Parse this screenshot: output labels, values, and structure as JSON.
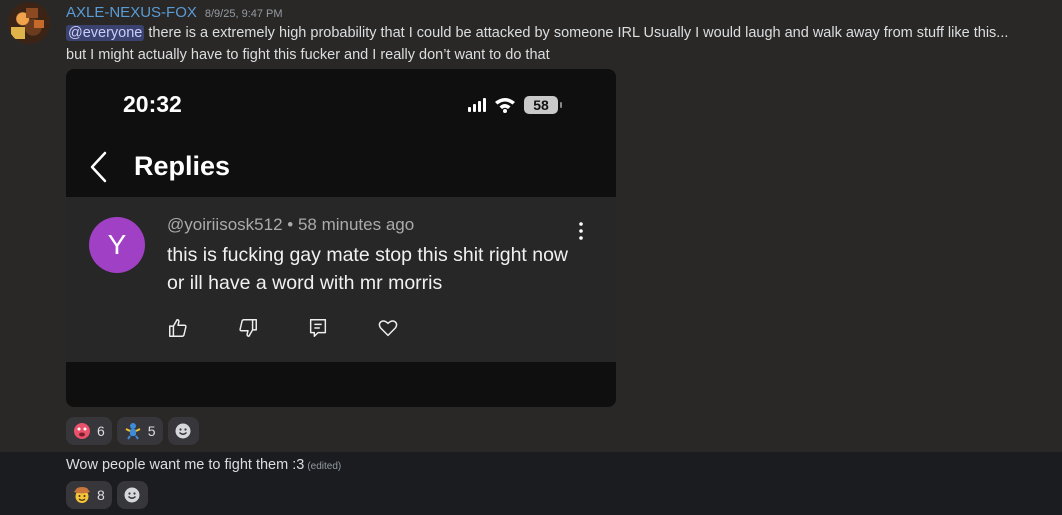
{
  "message": {
    "author": "AXLE-NEXUS-FOX",
    "timestamp": "8/9/25, 9:47 PM",
    "mention": "@everyone",
    "line1_rest": " there is a extremely high probability that I could be attacked by someone IRL Usually I would laugh and walk away from stuff like this...",
    "line2": "but I might actually have to fight this fucker and I really don’t want to do that"
  },
  "screenshot": {
    "status_time": "20:32",
    "battery": "58",
    "header_title": "Replies",
    "comment": {
      "avatar_letter": "Y",
      "avatar_color": "#a040c4",
      "handle": "@yoiriisosk512",
      "separator": " • ",
      "time_ago": "58 minutes ago",
      "body": "this is fucking gay mate stop this shit right now or ill have a word with mr morris"
    }
  },
  "reactions": [
    {
      "emoji": "red-face-emoji",
      "count": "6"
    },
    {
      "emoji": "blue-figure-emoji",
      "count": "5"
    }
  ],
  "followup": {
    "text": "Wow people want me to fight them :3",
    "edited_label": "(edited)",
    "reactions": [
      {
        "emoji": "cowboy-emoji",
        "count": "8"
      }
    ]
  },
  "colors": {
    "username": "#5a9bd6",
    "mention_bg": "#3c4270",
    "background": "#2a2826",
    "followup_bg": "#1b1c1f"
  }
}
